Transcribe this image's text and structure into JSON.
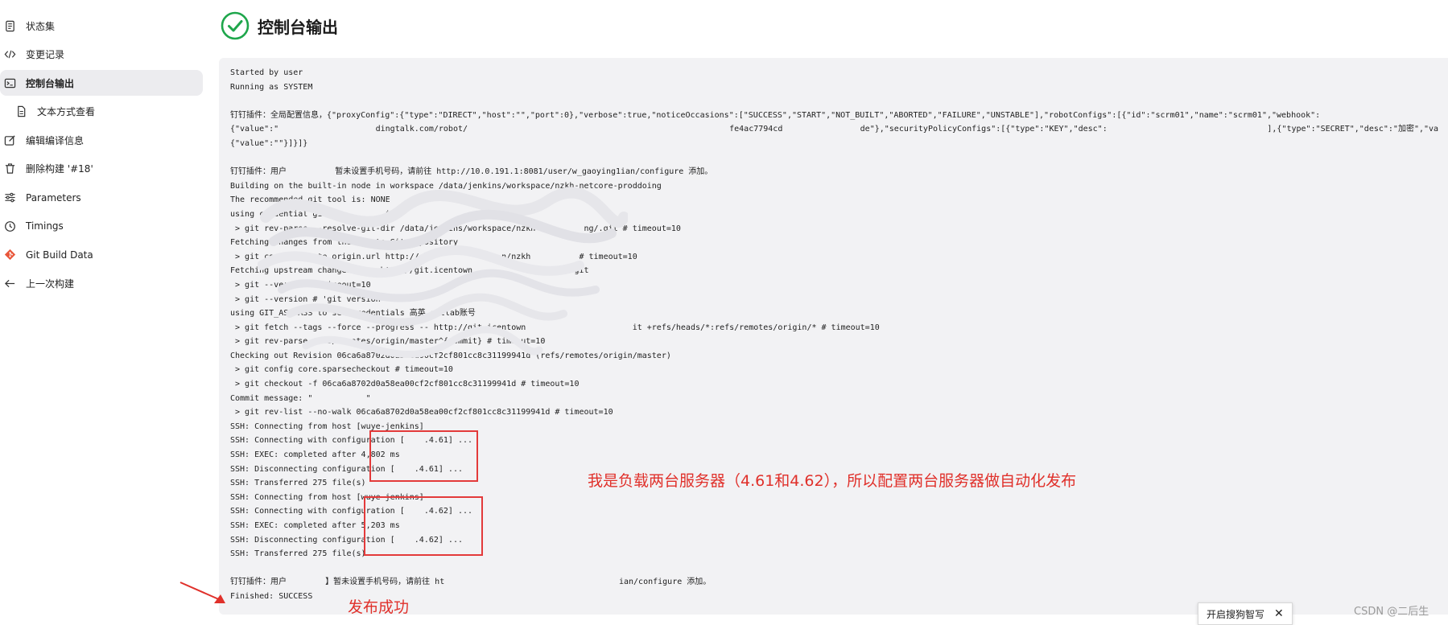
{
  "sidebar": {
    "items": [
      {
        "label": "状态集",
        "icon": "document-icon"
      },
      {
        "label": "变更记录",
        "icon": "code-icon"
      },
      {
        "label": "控制台输出",
        "icon": "terminal-icon"
      },
      {
        "label": "文本方式查看",
        "icon": "file-icon"
      },
      {
        "label": "编辑编译信息",
        "icon": "edit-icon"
      },
      {
        "label": "删除构建 '#18'",
        "icon": "trash-icon"
      },
      {
        "label": "Parameters",
        "icon": "sliders-icon"
      },
      {
        "label": "Timings",
        "icon": "clock-icon"
      },
      {
        "label": "Git Build Data",
        "icon": "git-icon"
      },
      {
        "label": "上一次构建",
        "icon": "arrow-left-icon"
      }
    ]
  },
  "page": {
    "title": "控制台输出",
    "status_icon": "success-check-icon",
    "status_color": "#1ea64b"
  },
  "console": {
    "lines": [
      "Started by user ",
      "Running as SYSTEM",
      "",
      "钉钉插件：全局配置信息，{\"proxyConfig\":{\"type\":\"DIRECT\",\"host\":\"\",\"port\":0},\"verbose\":true,\"noticeOccasions\":[\"SUCCESS\",\"START\",\"NOT_BUILT\",\"ABORTED\",\"FAILURE\",\"UNSTABLE\"],\"robotConfigs\":[{\"id\":\"scrm01\",\"name\":\"scrm01\",\"webhook\":",
      "{\"value\":\"                    dingtalk.com/robot/                                                      fe4ac7794cd                de\"},\"securityPolicyConfigs\":[{\"type\":\"KEY\",\"desc\":                                 ],{\"type\":\"SECRET\",\"desc\":\"加密\",\"value\":",
      "{\"value\":\"\"}]}]}",
      "",
      "钉钉插件：用户          暂未设置手机号码，请前往 http://10.0.191.1:8081/user/w_gaoying1ian/configure 添加。",
      "Building on the built-in node in workspace /data/jenkins/workspace/nzkh-netcore-proddoing",
      "The recommended git tool is: NONE",
      "using credential gitlab         ian",
      " > git rev-parse --resolve-git-dir /data/jenkins/workspace/nzkh          ng/.git # timeout=10",
      "Fetching changes from the remote Git repository",
      " > git config remote.origin.url http://                 n/nzkh          # timeout=10",
      "Fetching upstream changes from http://git.icentown                    .git",
      " > git --version # timeout=10",
      " > git --version # 'git version         '",
      "using GIT_ASKPASS to set credentials 高英 gitlab账号",
      " > git fetch --tags --force --progress -- http://git.icentown                      it +refs/heads/*:refs/remotes/origin/* # timeout=10",
      " > git rev-parse refs/remotes/origin/master^{commit} # timeout=10",
      "Checking out Revision 06ca6a8702d0a58ea00cf2cf801cc8c31199941d (refs/remotes/origin/master)",
      " > git config core.sparsecheckout # timeout=10",
      " > git checkout -f 06ca6a8702d0a58ea00cf2cf801cc8c31199941d # timeout=10",
      "Commit message: \"           \"",
      " > git rev-list --no-walk 06ca6a8702d0a58ea00cf2cf801cc8c31199941d # timeout=10",
      "SSH: Connecting from host [wuye-jenkins]",
      "SSH: Connecting with configuration [    .4.61] ...",
      "SSH: EXEC: completed after 4,802 ms",
      "SSH: Disconnecting configuration [    .4.61] ...",
      "SSH: Transferred 275 file(s)",
      "SSH: Connecting from host [wuye-jenkins]",
      "SSH: Connecting with configuration [    .4.62] ...",
      "SSH: EXEC: completed after 5,203 ms",
      "SSH: Disconnecting configuration [    .4.62] ...",
      "SSH: Transferred 275 file(s)",
      "",
      "钉钉插件：用户        】暂未设置手机号码，请前往 ht                                    ian/configure 添加。",
      "Finished: SUCCESS"
    ]
  },
  "annotations": {
    "servers_note": "我是负载两台服务器（4.61和4.62），所以配置两台服务器做自动化发布",
    "success_note": "发布成功",
    "color": "#e0302a"
  },
  "toast": {
    "label": "开启搜狗智写",
    "close": "✕"
  },
  "watermark": "CSDN @二后生"
}
